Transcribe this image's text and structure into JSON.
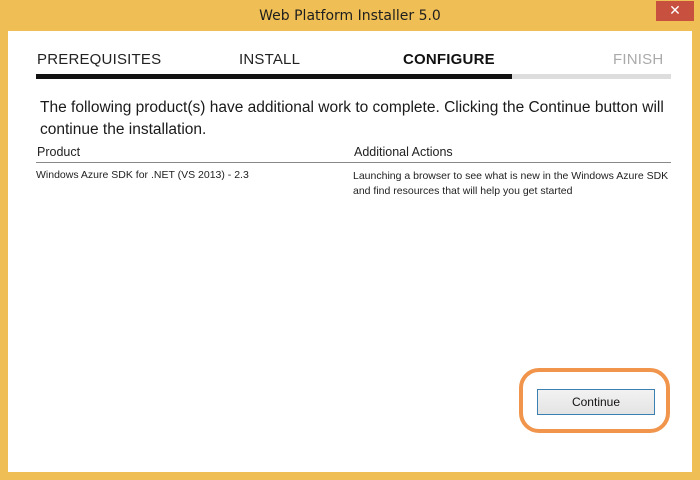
{
  "window": {
    "title": "Web Platform Installer 5.0",
    "close_glyph": "✕"
  },
  "steps": [
    {
      "label": "PREREQUISITES"
    },
    {
      "label": "INSTALL"
    },
    {
      "label": "CONFIGURE"
    },
    {
      "label": "FINISH"
    }
  ],
  "progress": {
    "current_step": 3,
    "total_steps": 4,
    "fraction_complete": 0.75
  },
  "message": "The following product(s) have additional work to complete. Clicking the Continue button will continue the installation.",
  "table": {
    "headers": {
      "product": "Product",
      "actions": "Additional Actions"
    },
    "rows": [
      {
        "product": "Windows Azure SDK for .NET (VS 2013) - 2.3",
        "actions": "Launching a browser to see what is new in the Windows Azure SDK and find resources that will help you get started"
      }
    ]
  },
  "buttons": {
    "continue": "Continue"
  },
  "colors": {
    "window_frame": "#efbf55",
    "close_button": "#c7503f",
    "highlight_ring": "#f0954b",
    "progress_active": "#111111",
    "progress_inactive": "#dddddd",
    "finish_inactive_text": "#aaaaaa"
  }
}
